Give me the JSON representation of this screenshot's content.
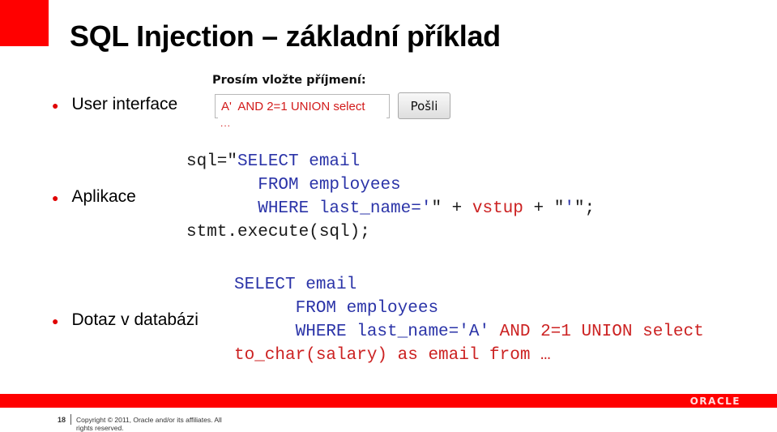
{
  "slide": {
    "title": "SQL Injection – základní příklad",
    "accent_color": "#ff0000"
  },
  "bullets": [
    {
      "label": "User interface"
    },
    {
      "label": "Aplikace"
    },
    {
      "label": "Dotaz v databázi"
    }
  ],
  "form": {
    "label": "Prosím vložte příjmení:",
    "input_value": "A'  AND 2=1 UNION select",
    "input_overflow": "...",
    "submit_label": "Pošli"
  },
  "app_code": {
    "line1_a": "sql=\"",
    "line1_b": "SELECT email",
    "line2": "       FROM employees",
    "line3_a": "       WHERE last_name='",
    "line3_b": "\" + ",
    "line3_c": "vstup",
    "line3_d": " + \"",
    "line3_e": "'",
    "line3_f": "\";",
    "line4": "stmt.execute(sql);"
  },
  "db_query": {
    "line1": "SELECT email",
    "line2": "      FROM employees",
    "line3_a": "      WHERE last_name='A'",
    "line3_b": " AND 2=1 UNION select",
    "line4": "to_char(salary) as email from …"
  },
  "footer": {
    "page_number": "18",
    "copyright": "Copyright © 2011, Oracle and/or its affiliates. All rights reserved.",
    "logo": "ORACLE"
  }
}
